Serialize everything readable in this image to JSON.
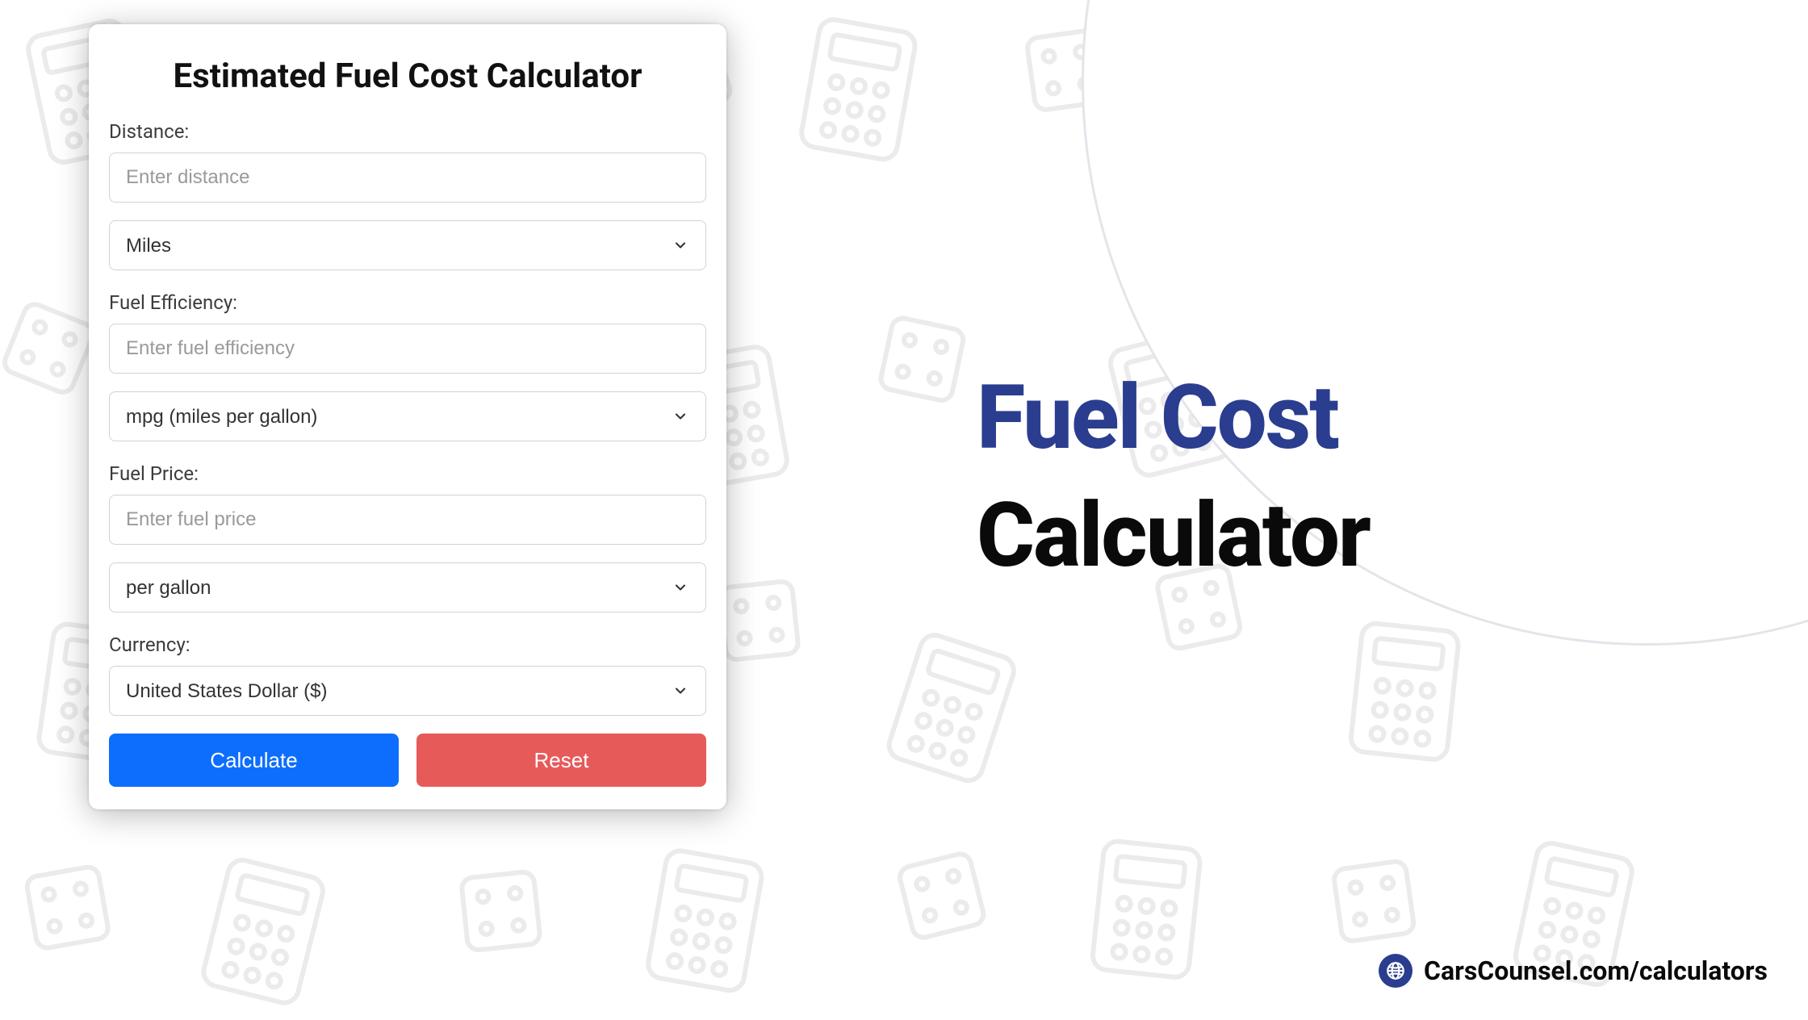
{
  "card": {
    "title": "Estimated Fuel Cost Calculator",
    "distance_label": "Distance:",
    "distance_placeholder": "Enter distance",
    "distance_unit_selected": "Miles",
    "efficiency_label": "Fuel Efficiency:",
    "efficiency_placeholder": "Enter fuel efficiency",
    "efficiency_unit_selected": "mpg (miles per gallon)",
    "price_label": "Fuel Price:",
    "price_placeholder": "Enter fuel price",
    "price_unit_selected": "per gallon",
    "currency_label": "Currency:",
    "currency_selected": "United States Dollar ($)",
    "calculate_label": "Calculate",
    "reset_label": "Reset"
  },
  "hero": {
    "line1": "Fuel Cost",
    "line2": "Calculator"
  },
  "footer": {
    "url": "CarsCounsel.com/calculators"
  }
}
